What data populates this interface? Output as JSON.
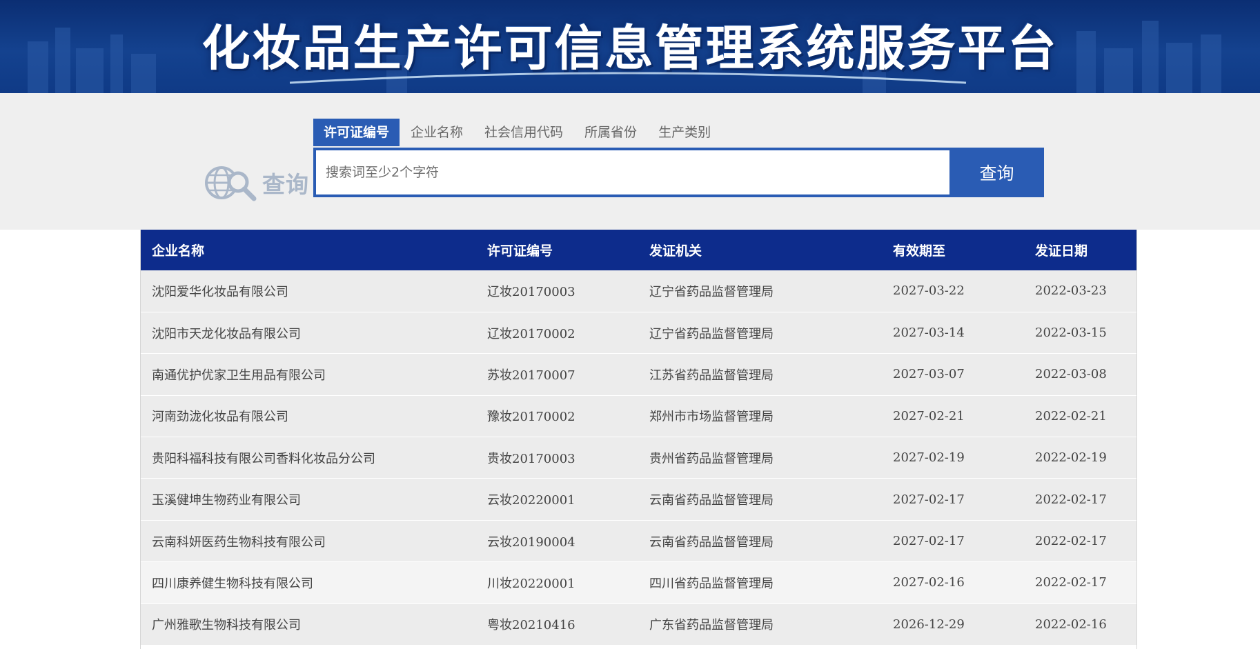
{
  "header": {
    "title": "化妆品生产许可信息管理系统服务平台"
  },
  "search": {
    "logo_text": "查询",
    "tabs": [
      {
        "label": "许可证编号",
        "active": true
      },
      {
        "label": "企业名称",
        "active": false
      },
      {
        "label": "社会信用代码",
        "active": false
      },
      {
        "label": "所属省份",
        "active": false
      },
      {
        "label": "生产类别",
        "active": false
      }
    ],
    "placeholder": "搜索词至少2个字符",
    "button_label": "查询"
  },
  "table": {
    "columns": [
      "企业名称",
      "许可证编号",
      "发证机关",
      "有效期至",
      "发证日期"
    ],
    "rows": [
      [
        "沈阳爱华化妆品有限公司",
        "辽妆20170003",
        "辽宁省药品监督管理局",
        "2027-03-22",
        "2022-03-23"
      ],
      [
        "沈阳市天龙化妆品有限公司",
        "辽妆20170002",
        "辽宁省药品监督管理局",
        "2027-03-14",
        "2022-03-15"
      ],
      [
        "南通优护优家卫生用品有限公司",
        "苏妆20170007",
        "江苏省药品监督管理局",
        "2027-03-07",
        "2022-03-08"
      ],
      [
        "河南劲泷化妆品有限公司",
        "豫妆20170002",
        "郑州市市场监督管理局",
        "2027-02-21",
        "2022-02-21"
      ],
      [
        "贵阳科福科技有限公司香料化妆品分公司",
        "贵妆20170003",
        "贵州省药品监督管理局",
        "2027-02-19",
        "2022-02-19"
      ],
      [
        "玉溪健坤生物药业有限公司",
        "云妆20220001",
        "云南省药品监督管理局",
        "2027-02-17",
        "2022-02-17"
      ],
      [
        "云南科妍医药生物科技有限公司",
        "云妆20190004",
        "云南省药品监督管理局",
        "2027-02-17",
        "2022-02-17"
      ],
      [
        "四川康养健生物科技有限公司",
        "川妆20220001",
        "四川省药品监督管理局",
        "2027-02-16",
        "2022-02-17"
      ],
      [
        "广州雅歌生物科技有限公司",
        "粤妆20210416",
        "广东省药品监督管理局",
        "2026-12-29",
        "2022-02-16"
      ]
    ]
  },
  "colors": {
    "banner": "#14428f",
    "accent": "#2a5cb4",
    "table_header": "#0d2c8c"
  }
}
